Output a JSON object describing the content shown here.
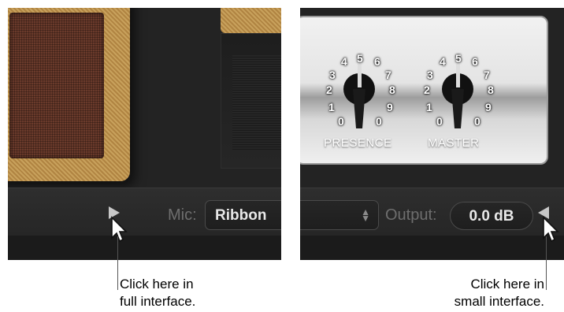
{
  "left_panel": {
    "mic_label": "Mic:",
    "mic_value": "Ribbon",
    "toggle_icon": "triangle-right-icon"
  },
  "right_panel": {
    "knobs": [
      {
        "label": "PRESENCE",
        "scale": [
          "0",
          "1",
          "2",
          "3",
          "4",
          "5",
          "6",
          "7",
          "8",
          "9",
          "0"
        ]
      },
      {
        "label": "MASTER",
        "scale": [
          "0",
          "1",
          "2",
          "3",
          "4",
          "5",
          "6",
          "7",
          "8",
          "9",
          "0"
        ]
      }
    ],
    "output_label": "Output:",
    "output_value": "0.0 dB",
    "toggle_icon": "triangle-left-icon"
  },
  "captions": {
    "full": [
      "Click here in",
      "full interface."
    ],
    "small": [
      "Click here in",
      "small interface."
    ]
  }
}
